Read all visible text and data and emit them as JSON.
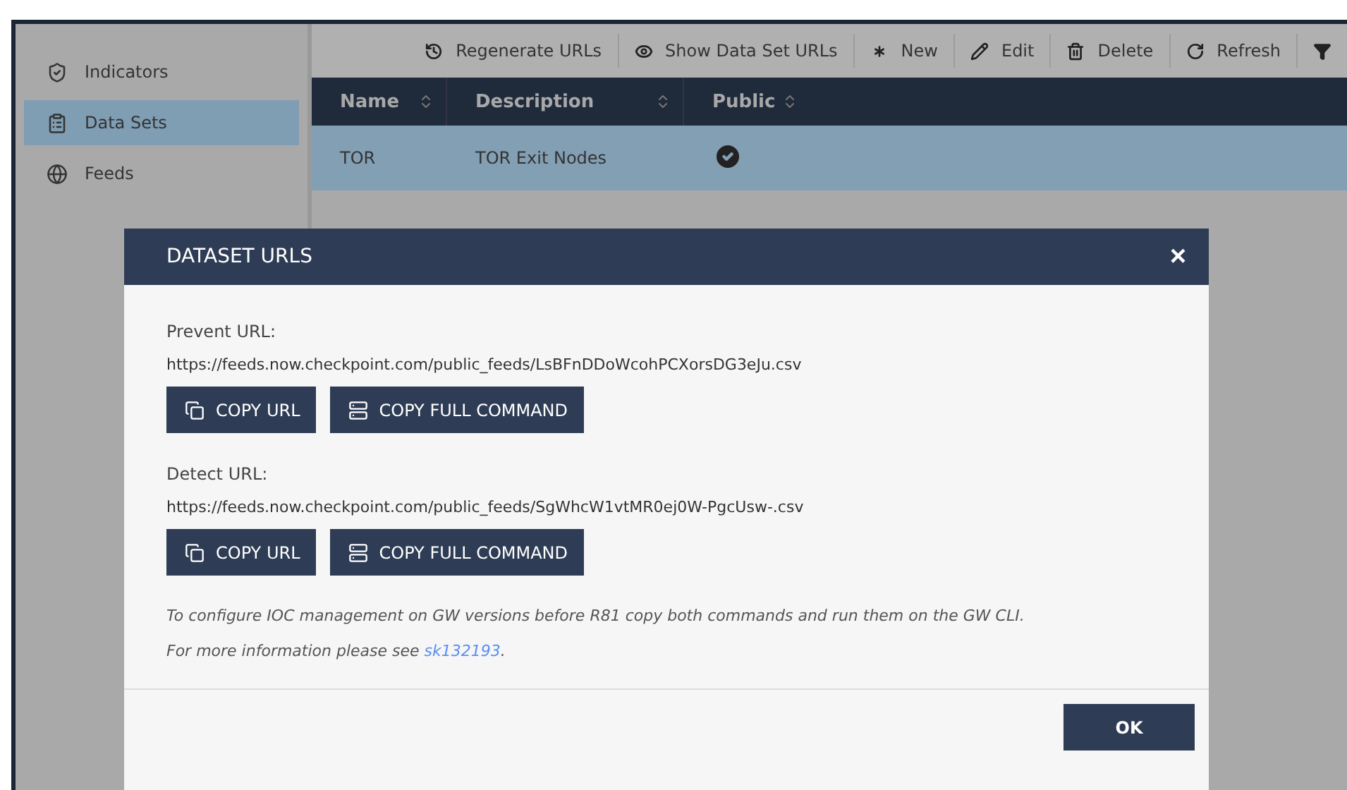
{
  "sidebar": {
    "items": [
      {
        "label": "Indicators",
        "selected": false
      },
      {
        "label": "Data Sets",
        "selected": true
      },
      {
        "label": "Feeds",
        "selected": false
      }
    ]
  },
  "toolbar": {
    "buttons": [
      "Regenerate URLs",
      "Show Data Set URLs",
      "New",
      "Edit",
      "Delete",
      "Refresh"
    ]
  },
  "table": {
    "columns": [
      "Name",
      "Description",
      "Public"
    ],
    "rows": [
      {
        "name": "TOR",
        "description": "TOR Exit Nodes",
        "public": true,
        "selected": true
      }
    ]
  },
  "dialog": {
    "title": "DATASET URLS",
    "close": "×",
    "sections": [
      {
        "label": "Prevent URL:",
        "url": "https://feeds.now.checkpoint.com/public_feeds/LsBFnDDoWcohPCXorsDG3eJu.csv",
        "buttons": [
          "COPY URL",
          "COPY FULL COMMAND"
        ]
      },
      {
        "label": "Detect URL:",
        "url": "https://feeds.now.checkpoint.com/public_feeds/SgWhcW1vtMR0ej0W-PgcUsw-.csv",
        "buttons": [
          "COPY URL",
          "COPY FULL COMMAND"
        ]
      }
    ],
    "note": "To configure IOC management on GW versions before R81 copy both commands and run them on the GW CLI.",
    "info": {
      "text": "For more information please see ",
      "link": "sk132193",
      "after": "."
    },
    "ok": "OK"
  }
}
